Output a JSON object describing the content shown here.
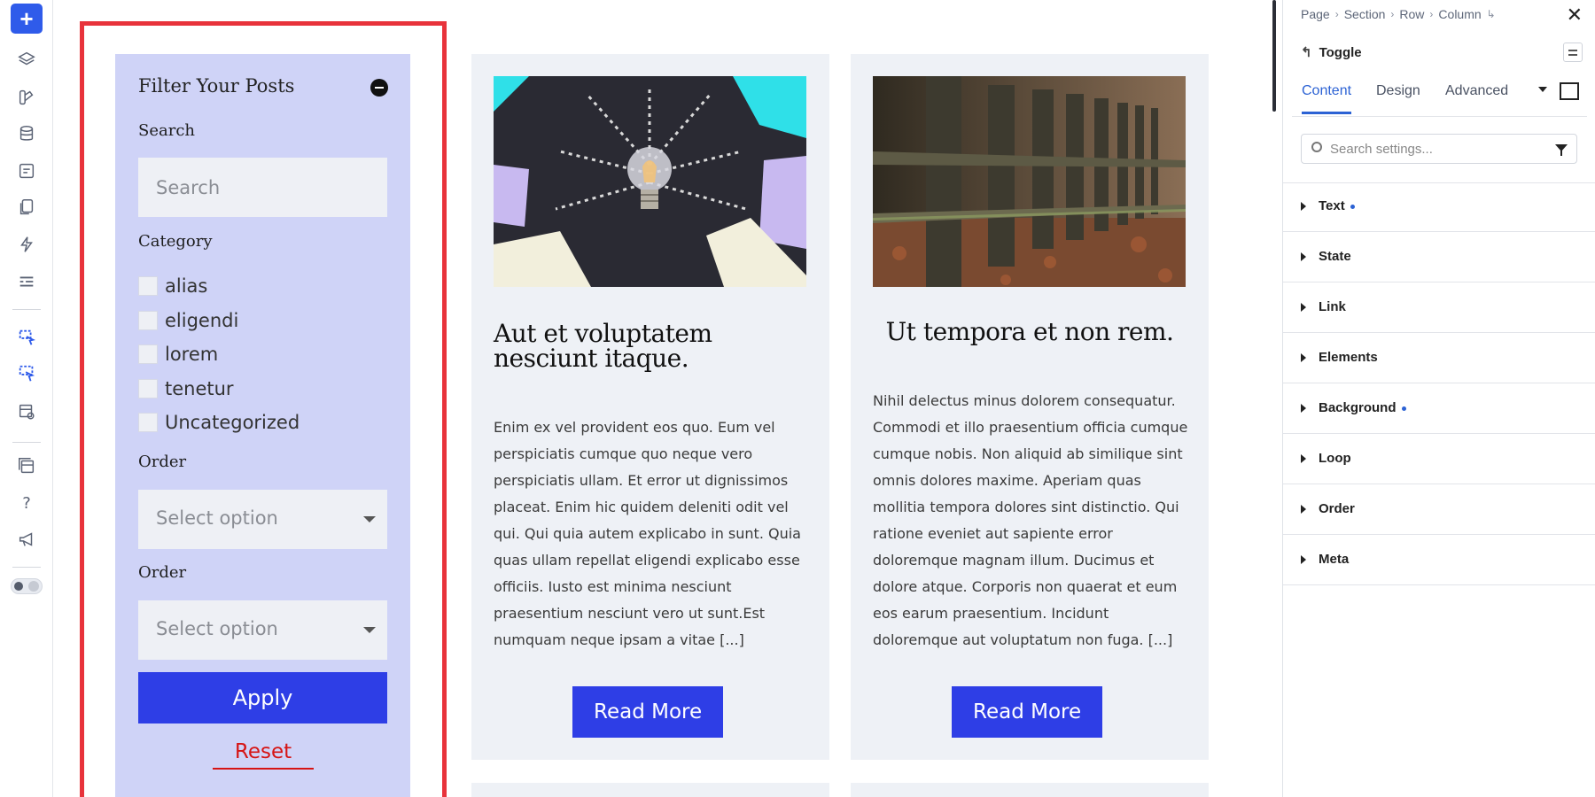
{
  "toolbar": {
    "add_label": "+",
    "icons": [
      "layers-icon",
      "style-icon",
      "database-icon",
      "form-icon",
      "pages-icon",
      "lightning-icon",
      "list-icon",
      "select-element-icon",
      "select-multiple-icon",
      "layout-view-icon",
      "templates-icon",
      "help-icon",
      "megaphone-icon",
      "theme-toggle-icon"
    ],
    "help_label": "?"
  },
  "filter": {
    "title": "Filter Your Posts",
    "search_label": "Search",
    "search_placeholder": "Search",
    "category_label": "Category",
    "categories": [
      "alias",
      "eligendi",
      "lorem",
      "tenetur",
      "Uncategorized"
    ],
    "order_label_1": "Order",
    "order_select_1": "Select option",
    "order_label_2": "Order",
    "order_select_2": "Select option",
    "apply_label": "Apply",
    "reset_label": "Reset"
  },
  "posts": [
    {
      "title": "Aut et voluptatem nesciunt itaque.",
      "body": "Enim ex vel provident eos quo. Eum vel perspiciatis cumque quo neque vero perspiciatis ullam. Et error ut dignissimos placeat. Enim hic quidem deleniti odit vel qui. Qui quia autem explicabo in sunt. Quia quas ullam repellat eligendi explicabo esse officiis. Iusto est minima nesciunt praesentium nesciunt vero ut sunt.Est numquam neque ipsam a vitae [...]",
      "button": "Read More",
      "image": "lightbulb-image"
    },
    {
      "title": "Ut tempora et non rem.",
      "body": "Nihil delectus minus dolorem consequatur. Commodi et illo praesentium officia cumque cumque nobis. Non aliquid ab similique sint omnis dolores maxime. Aperiam quas mollitia tempora dolores sint distinctio. Qui ratione eveniet aut sapiente error doloremque magnam illum. Ducimus et dolore atque. Corporis non quaerat et eum eos earum praesentium. Incidunt doloremque aut voluptatum non fuga. [...]",
      "button": "Read More",
      "image": "fence-image"
    }
  ],
  "panel": {
    "breadcrumbs": [
      "Page",
      "Section",
      "Row",
      "Column"
    ],
    "close_label": "✕",
    "element_title": "Toggle",
    "tabs": [
      "Content",
      "Design",
      "Advanced"
    ],
    "active_tab": "Content",
    "search_placeholder": "Search settings...",
    "sections": [
      {
        "label": "Text",
        "modified": true
      },
      {
        "label": "State",
        "modified": false
      },
      {
        "label": "Link",
        "modified": false
      },
      {
        "label": "Elements",
        "modified": false
      },
      {
        "label": "Background",
        "modified": true
      },
      {
        "label": "Loop",
        "modified": false
      },
      {
        "label": "Order",
        "modified": false
      },
      {
        "label": "Meta",
        "modified": false
      }
    ]
  },
  "colors": {
    "accent": "#2e3ee6",
    "selection_outline": "#e8333b",
    "filter_bg": "#cfd3f7",
    "reset": "#d61414",
    "panel_accent": "#2c62d4"
  }
}
